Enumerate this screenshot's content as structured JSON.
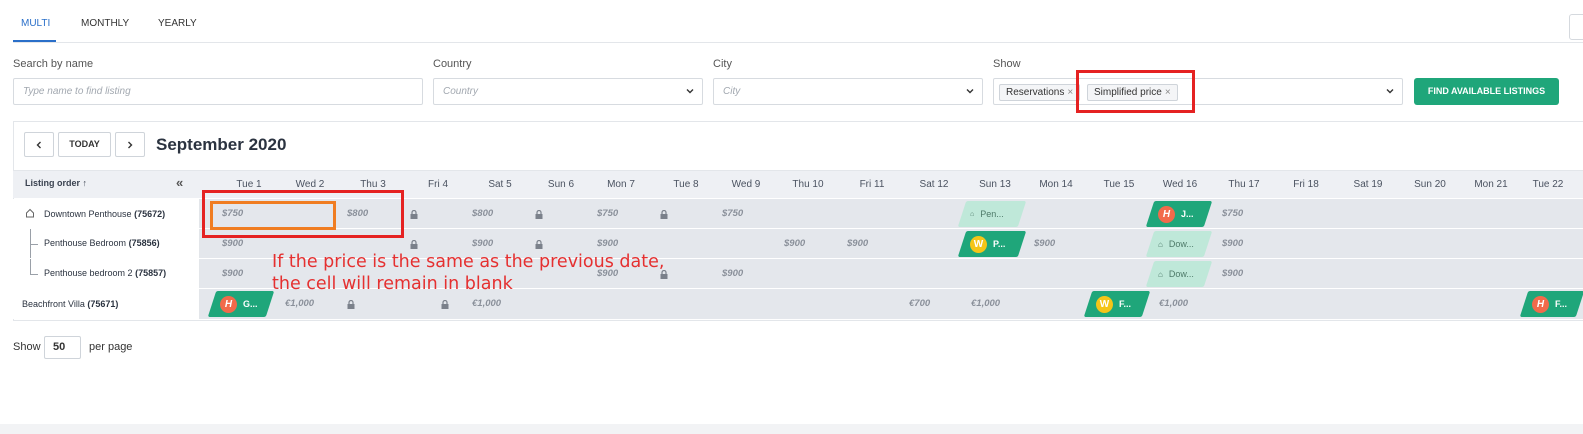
{
  "tabs": [
    {
      "label": "MULTI",
      "active": true
    },
    {
      "label": "MONTHLY",
      "active": false
    },
    {
      "label": "YEARLY",
      "active": false
    }
  ],
  "filters": {
    "search_label": "Search by name",
    "search_placeholder": "Type name to find listing",
    "country_label": "Country",
    "country_placeholder": "Country",
    "city_label": "City",
    "city_placeholder": "City",
    "show_label": "Show",
    "show_chips": [
      "Reservations",
      "Simplified price"
    ],
    "find_button": "FIND AVAILABLE LISTINGS"
  },
  "calendar": {
    "today_button": "TODAY",
    "month_title": "September 2020",
    "listing_order_label": "Listing order ↑",
    "days": [
      "Tue 1",
      "Wed 2",
      "Thu 3",
      "Fri 4",
      "Sat 5",
      "Sun 6",
      "Mon 7",
      "Tue 8",
      "Wed 9",
      "Thu 10",
      "Fri 11",
      "Sat 12",
      "Sun 13",
      "Mon 14",
      "Tue 15",
      "Wed 16",
      "Thu 17",
      "Fri 18",
      "Sat 19",
      "Sun 20",
      "Mon 21",
      "Tue 22"
    ],
    "listings": [
      {
        "name": "Downtown Penthouse",
        "id": "(75672)"
      },
      {
        "name": "Penthouse Bedroom",
        "id": "(75856)"
      },
      {
        "name": "Penthouse bedroom 2",
        "id": "(75857)"
      },
      {
        "name": "Beachfront Villa",
        "id": "(75671)"
      }
    ],
    "prices": {
      "r0": [
        "$750",
        "$800",
        "$800",
        "$750",
        "$750",
        "$750"
      ],
      "r1": [
        "$900",
        "$900",
        "$900",
        "$900",
        "$900",
        "$900",
        "$900"
      ],
      "r2": [
        "$900",
        "$900",
        "$900",
        "$900"
      ],
      "r3": [
        "€1,000",
        "€1,000",
        "€700",
        "€1,000",
        "€1,000"
      ]
    },
    "reservations": {
      "r0_sun13": "Pen...",
      "r0_wed16": "J...",
      "r1_sun13": "P...",
      "r1_wed16": "Dow...",
      "r2_wed16": "Dow...",
      "r3_tue1": "G...",
      "r3_tue15": "F...",
      "r3_tue22": "F..."
    },
    "avatar_letters": {
      "h": "H",
      "w": "W"
    }
  },
  "annotation": "If the price is the same as the previous date, the cell will remain in blank",
  "pagination": {
    "show_label": "Show",
    "per_page_value": "50",
    "per_page_label": "per page"
  },
  "colors": {
    "accent": "#2a6fc9",
    "green": "#1fa67a",
    "highlight_red": "#e52222",
    "highlight_orange": "#f07d22"
  }
}
